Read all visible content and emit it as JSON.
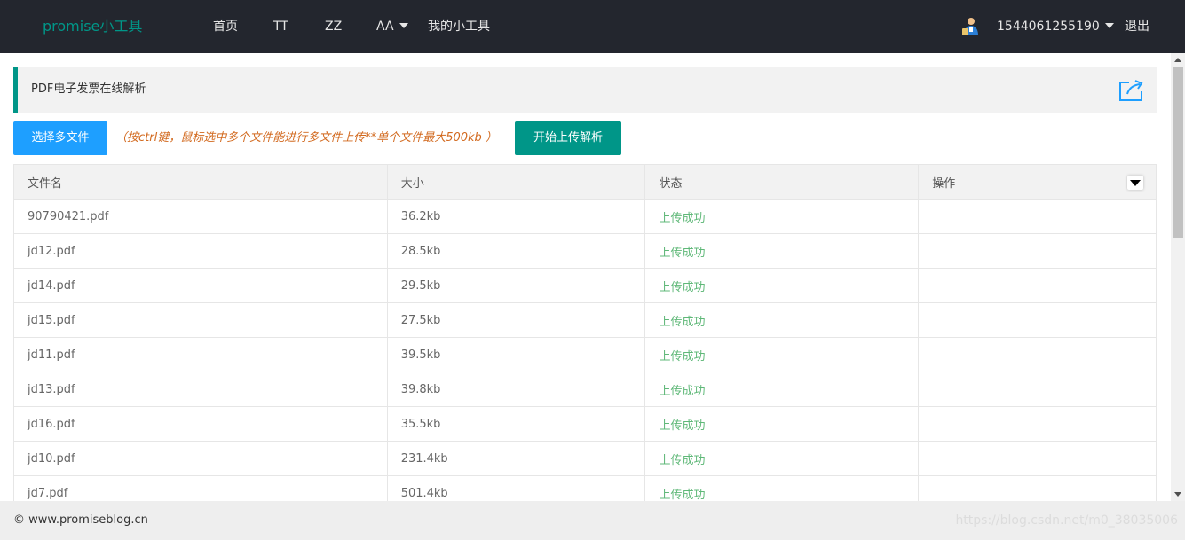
{
  "header": {
    "logo": "promise小工具",
    "nav": [
      "首页",
      "TT",
      "ZZ",
      "AA",
      "我的小工具"
    ],
    "username": "1544061255190",
    "logout": "退出"
  },
  "page": {
    "title": "PDF电子发票在线解析"
  },
  "toolbar": {
    "select_label": "选择多文件",
    "hint": "（按ctrl键，鼠标选中多个文件能进行多文件上传**单个文件最大500kb ）",
    "upload_label": "开始上传解析"
  },
  "table": {
    "columns": [
      "文件名",
      "大小",
      "状态",
      "操作"
    ],
    "rows": [
      {
        "name": "90790421.pdf",
        "size": "36.2kb",
        "status": "上传成功"
      },
      {
        "name": "jd12.pdf",
        "size": "28.5kb",
        "status": "上传成功"
      },
      {
        "name": "jd14.pdf",
        "size": "29.5kb",
        "status": "上传成功"
      },
      {
        "name": "jd15.pdf",
        "size": "27.5kb",
        "status": "上传成功"
      },
      {
        "name": "jd11.pdf",
        "size": "39.5kb",
        "status": "上传成功"
      },
      {
        "name": "jd13.pdf",
        "size": "39.8kb",
        "status": "上传成功"
      },
      {
        "name": "jd16.pdf",
        "size": "35.5kb",
        "status": "上传成功"
      },
      {
        "name": "jd10.pdf",
        "size": "231.4kb",
        "status": "上传成功"
      },
      {
        "name": "jd7.pdf",
        "size": "501.4kb",
        "status": "上传成功"
      }
    ]
  },
  "footer": {
    "copyright": "© www.promiseblog.cn",
    "watermark": "https://blog.csdn.net/m0_38035006"
  },
  "colors": {
    "nav_bg": "#23262e",
    "accent": "#009688",
    "primary": "#1e9fff",
    "success": "#5fb878",
    "hint": "#d2691e"
  },
  "icons": {
    "user": "user-avatar-icon",
    "share": "share-icon",
    "filter": "filter-dropdown-icon"
  }
}
